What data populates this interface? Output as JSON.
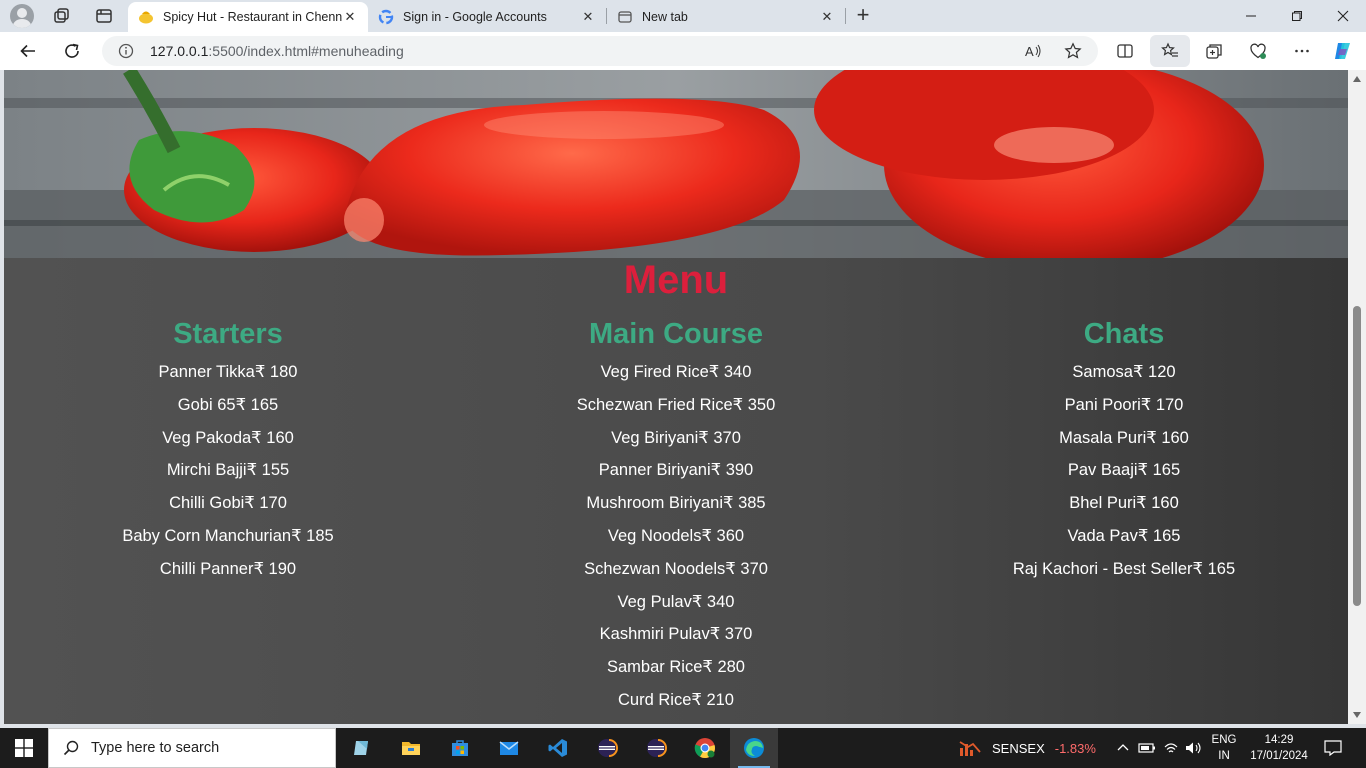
{
  "browser": {
    "tabs": [
      {
        "title": "Spicy Hut - Restaurant in Chenna",
        "active": true
      },
      {
        "title": "Sign in - Google Accounts",
        "active": false
      },
      {
        "title": "New tab",
        "active": false
      }
    ],
    "close_glyph": "✕",
    "new_tab_glyph": "+",
    "address": {
      "host": "127.0.0.1",
      "path": ":5500/index.html#menuheading"
    }
  },
  "page": {
    "menu_heading": "Menu",
    "columns": [
      {
        "heading": "Starters",
        "items": [
          "Panner Tikka₹ 180",
          "Gobi 65₹ 165",
          "Veg Pakoda₹ 160",
          "Mirchi Bajji₹ 155",
          "Chilli Gobi₹ 170",
          "Baby Corn Manchurian₹ 185",
          "Chilli Panner₹ 190"
        ]
      },
      {
        "heading": "Main Course",
        "items": [
          "Veg Fired Rice₹ 340",
          "Schezwan Fried Rice₹ 350",
          "Veg Biriyani₹ 370",
          "Panner Biriyani₹ 390",
          "Mushroom Biriyani₹ 385",
          "Veg Noodels₹ 360",
          "Schezwan Noodels₹ 370",
          "Veg Pulav₹ 340",
          "Kashmiri Pulav₹ 370",
          "Sambar Rice₹ 280",
          "Curd Rice₹ 210"
        ]
      },
      {
        "heading": "Chats",
        "items": [
          "Samosa₹ 120",
          "Pani Poori₹ 170",
          "Masala Puri₹ 160",
          "Pav Baaji₹ 165",
          "Bhel Puri₹ 160",
          "Vada Pav₹ 165",
          "Raj Kachori - Best Seller₹ 165"
        ]
      }
    ],
    "colors": {
      "menu_heading": "#dc1f3c",
      "column_heading": "#3daa83",
      "background": "#4f4f4f"
    }
  },
  "taskbar": {
    "search_placeholder": "Type here to search",
    "apps": [
      "notes-icon",
      "file-explorer-icon",
      "store-icon",
      "mail-icon",
      "vscode-icon",
      "eclipse-icon",
      "eclipse-icon",
      "chrome-icon",
      "edge-icon"
    ],
    "sensex": {
      "label": "SENSEX",
      "change": "-1.83%"
    },
    "language": {
      "line1": "ENG",
      "line2": "IN"
    },
    "clock": {
      "time": "14:29",
      "date": "17/01/2024"
    }
  }
}
